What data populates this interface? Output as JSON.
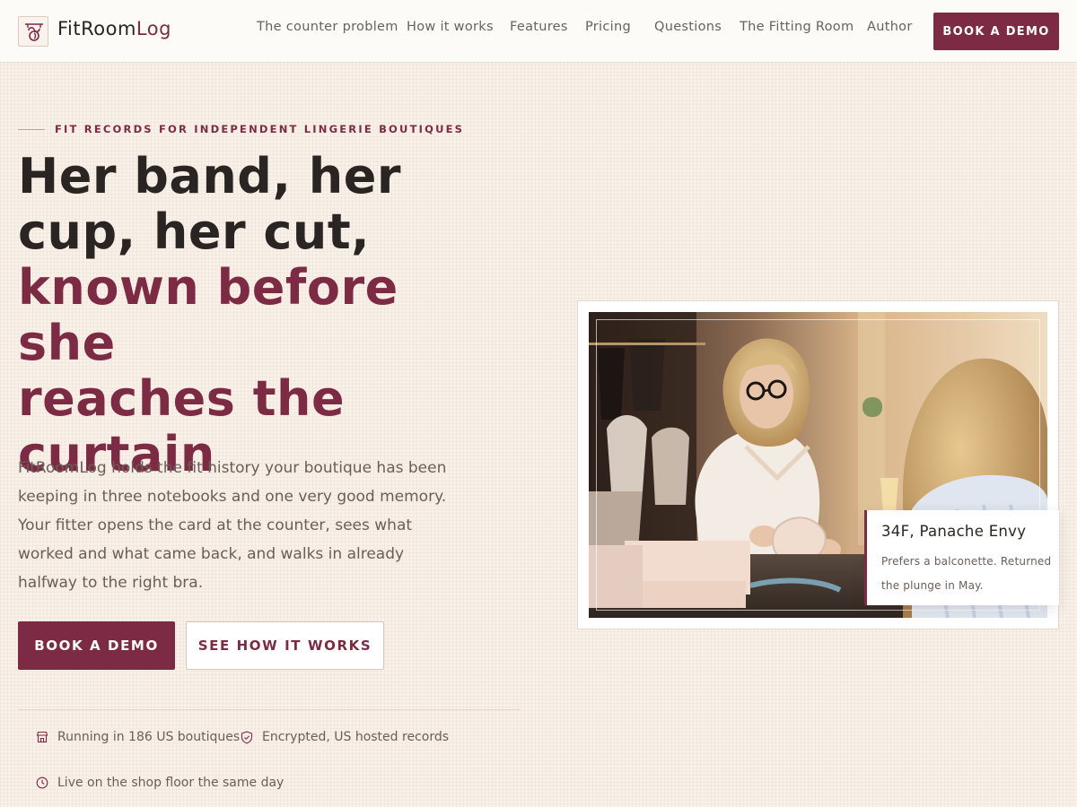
{
  "brand": {
    "name_prefix": "FitRoom",
    "name_suffix": "Log",
    "logo_icon": "hanger-curtain-icon"
  },
  "nav": {
    "items": [
      {
        "label": "The counter problem"
      },
      {
        "label": "How it works"
      },
      {
        "label": "Features"
      },
      {
        "label": "Pricing"
      },
      {
        "label": "Questions"
      },
      {
        "label": "The Fitting Room"
      },
      {
        "label": "Author"
      }
    ],
    "cta_label": "BOOK A DEMO"
  },
  "hero": {
    "eyebrow": "FIT RECORDS FOR INDEPENDENT LINGERIE BOUTIQUES",
    "headline_line1": "Her band, her",
    "headline_line2": "cup, her cut,",
    "headline_line3": "known before she",
    "headline_line4": "reaches the",
    "headline_line5": "curtain",
    "lede": "FitRoomLog holds the fit history your boutique has been keeping in three notebooks and one very good memory. Your fitter opens the card at the counter, sees what worked and what came back, and walks in already halfway to the right bra.",
    "primary_cta": "BOOK A DEMO",
    "secondary_cta": "SEE HOW IT WORKS",
    "trust": [
      {
        "icon": "storefront-icon",
        "label": "Running in 186 US boutiques"
      },
      {
        "icon": "shield-check-icon",
        "label": "Encrypted, US hosted records"
      },
      {
        "icon": "clock-icon",
        "label": "Live on the shop floor the same day"
      }
    ]
  },
  "fit_card": {
    "title": "34F, Panache Envy",
    "note": "Prefers a balconette. Returned the plunge in May."
  },
  "colors": {
    "accent": "#7d2b44",
    "background": "#f8f1ea",
    "text": "#2a2522",
    "muted": "#6a5e57"
  }
}
